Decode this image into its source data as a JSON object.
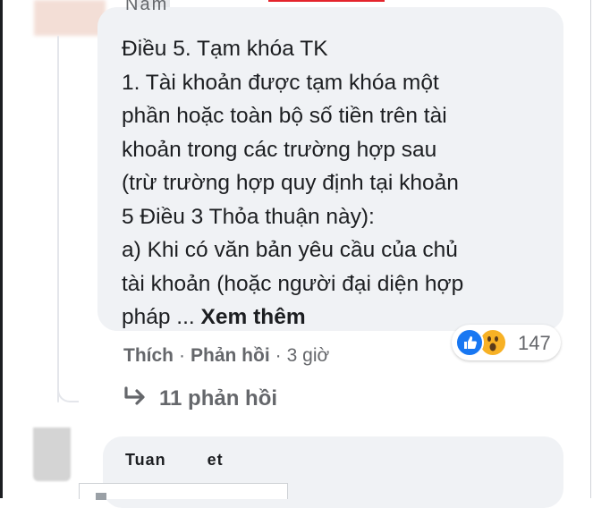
{
  "comment": {
    "author_partial": "Nam",
    "lines": [
      "Điều 5. Tạm khóa TK",
      "1. Tài khoản được tạm khóa một",
      "phần hoặc toàn bộ số tiền trên tài",
      "khoản trong các trường hợp sau",
      "(trừ trường hợp quy định tại khoản",
      "5 Điều 3 Thỏa thuận này):",
      "a) Khi có văn bản yêu cầu của chủ",
      "tài khoản (hoặc người đại diện hợp"
    ],
    "last_line_prefix": "pháp ...",
    "see_more": "Xem thêm",
    "reactions": {
      "count": "147",
      "types": [
        "like-icon",
        "wow-icon"
      ]
    },
    "actions": {
      "like": "Thích",
      "reply": "Phản hồi",
      "time": "3 giờ"
    },
    "replies_label": "11 phản hồi"
  },
  "next_comment": {
    "author_partial_1": "Tuan",
    "author_partial_2": "et"
  },
  "colors": {
    "bubble": "#f0f2f5",
    "text": "#1c1e21",
    "secondary": "#65676b",
    "like": "#1877f2",
    "wow": "#f7b125"
  }
}
